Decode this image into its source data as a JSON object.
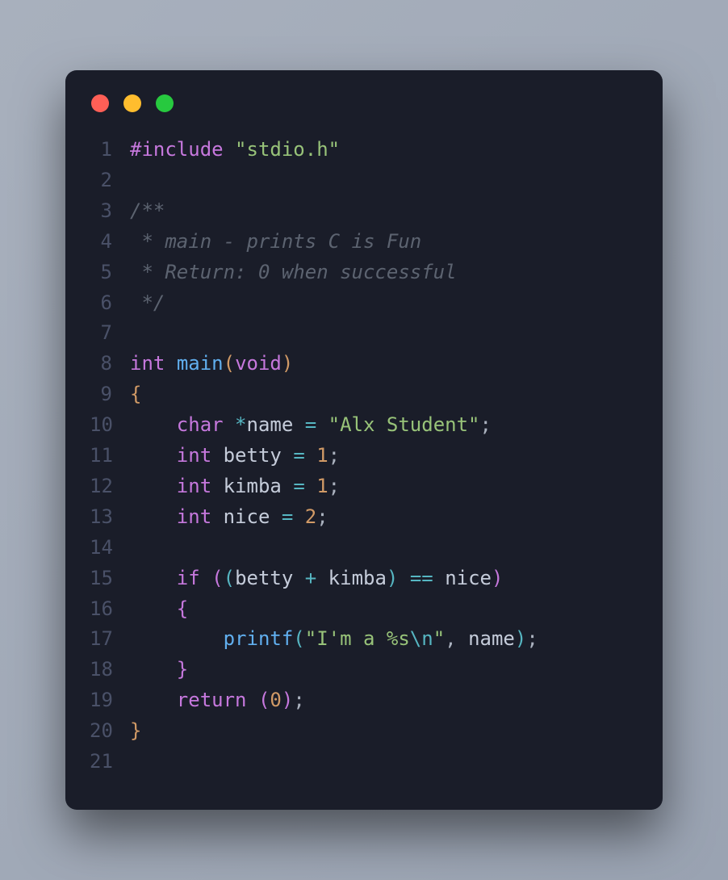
{
  "window": {
    "dots": [
      "red",
      "yellow",
      "green"
    ]
  },
  "code": {
    "line_count": 21,
    "tokens": {
      "l1_include": "#include",
      "l1_header": "\"stdio.h\"",
      "l3": "/**",
      "l4": " * main - prints C is Fun",
      "l5": " * Return: 0 when successful",
      "l6": " */",
      "l8_int": "int",
      "l8_main": "main",
      "l8_void": "void",
      "l10_char": "char",
      "l10_star": "*",
      "l10_name": "name",
      "l10_eq": "=",
      "l10_str": "\"Alx Student\"",
      "l11_int": "int",
      "l11_var": "betty",
      "l11_eq": "=",
      "l11_val": "1",
      "l12_int": "int",
      "l12_var": "kimba",
      "l12_eq": "=",
      "l12_val": "1",
      "l13_int": "int",
      "l13_var": "nice",
      "l13_eq": "=",
      "l13_val": "2",
      "l15_if": "if",
      "l15_betty": "betty",
      "l15_plus": "+",
      "l15_kimba": "kimba",
      "l15_eqeq": "==",
      "l15_nice": "nice",
      "l17_printf": "printf",
      "l17_str1": "\"I'm a %s",
      "l17_esc": "\\n",
      "l17_str2": "\"",
      "l17_name": "name",
      "l19_return": "return",
      "l19_val": "0",
      "brace_open": "{",
      "brace_close": "}",
      "paren_open": "(",
      "paren_close": ")",
      "semi": ";",
      "comma": ","
    }
  }
}
